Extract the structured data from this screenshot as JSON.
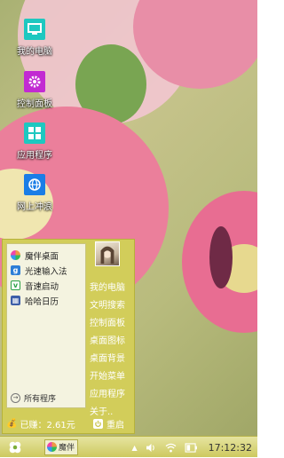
{
  "desktop_icons": [
    {
      "label": "我的电脑",
      "icon": "monitor-icon",
      "color": "#1ec8c0"
    },
    {
      "label": "控制面板",
      "icon": "gear-icon",
      "color": "#c22ad2"
    },
    {
      "label": "应用程序",
      "icon": "apps-grid-icon",
      "color": "#1ec8c0"
    },
    {
      "label": "网上冲浪",
      "icon": "globe-icon",
      "color": "#1a7de6"
    }
  ],
  "start_menu": {
    "apps": [
      {
        "label": "魔伴桌面",
        "icon": "pinwheel-icon"
      },
      {
        "label": "光速输入法",
        "icon": "g-keyboard-icon"
      },
      {
        "label": "音速启动",
        "icon": "v-launch-icon"
      },
      {
        "label": "哈哈日历",
        "icon": "calendar-icon"
      }
    ],
    "all_programs": "所有程序",
    "right_items": [
      "我的电脑",
      "文明搜索",
      "控制面板",
      "桌面图标",
      "桌面背景",
      "开始菜单",
      "应用程序",
      "关于.."
    ],
    "earned_label": "已赚：2.61元",
    "restart_label": "重启"
  },
  "taskbar": {
    "task_label": "魔伴",
    "clock": "17:12:32"
  },
  "colors": {
    "menu_bg": "#d2cd5a",
    "taskbar_bg": "#cdc95f"
  }
}
